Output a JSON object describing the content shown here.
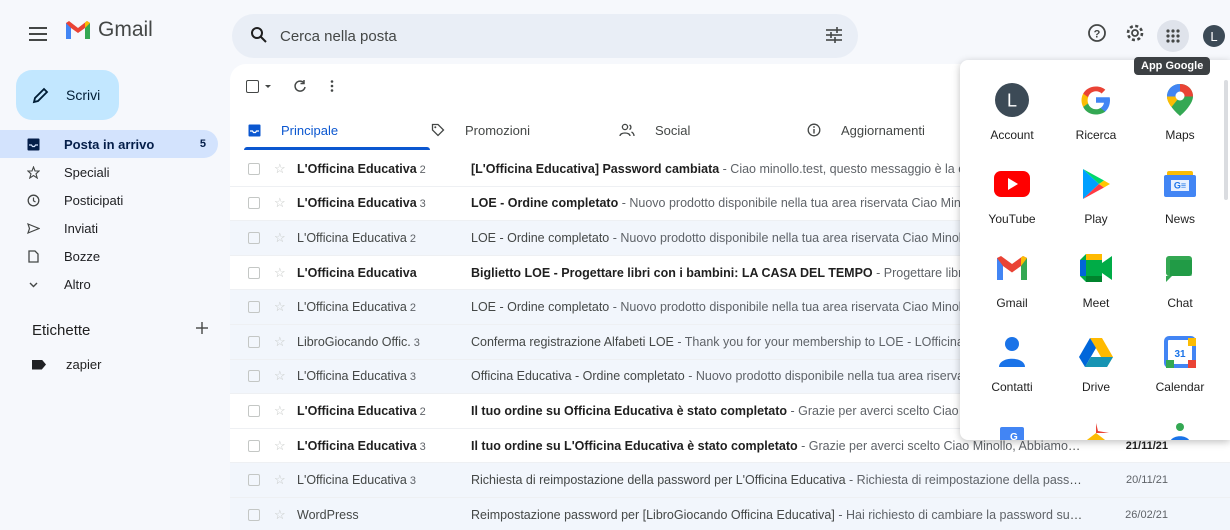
{
  "header": {
    "app_name": "Gmail",
    "search_placeholder": "Cerca nella posta",
    "avatar_initial": "L",
    "apps_tooltip": "App Google"
  },
  "sidebar": {
    "compose_label": "Scrivi",
    "items": [
      {
        "label": "Posta in arrivo",
        "count": "5",
        "icon": "inbox-icon",
        "active": true
      },
      {
        "label": "Speciali",
        "icon": "star-icon"
      },
      {
        "label": "Posticipati",
        "icon": "clock-icon"
      },
      {
        "label": "Inviati",
        "icon": "send-icon"
      },
      {
        "label": "Bozze",
        "icon": "draft-icon"
      },
      {
        "label": "Altro",
        "icon": "chevron-down-icon"
      }
    ],
    "labels_header": "Etichette",
    "labels": [
      {
        "name": "zapier"
      }
    ]
  },
  "tabs": [
    {
      "label": "Principale",
      "icon": "inbox-icon",
      "active": true
    },
    {
      "label": "Promozioni",
      "icon": "tag-icon"
    },
    {
      "label": "Social",
      "icon": "people-icon"
    },
    {
      "label": "Aggiornamenti",
      "icon": "info-icon"
    }
  ],
  "emails": [
    {
      "sender": "L'Officina Educativa",
      "count": "2",
      "subject": "[L'Officina Educativa] Password cambiata",
      "snippet": " - Ciao minollo.test, questo messaggio è la c",
      "date": "",
      "unread": true
    },
    {
      "sender": "L'Officina Educativa",
      "count": "3",
      "subject": "LOE - Ordine completato",
      "snippet": " - Nuovo prodotto disponibile nella tua area riservata Ciao Mino",
      "date": "",
      "unread": true
    },
    {
      "sender": "L'Officina Educativa",
      "count": "2",
      "subject": "LOE - Ordine completato",
      "snippet": " - Nuovo prodotto disponibile nella tua area riservata Ciao Minoll",
      "date": "",
      "unread": false
    },
    {
      "sender": "L'Officina Educativa",
      "count": "",
      "subject": "Biglietto LOE - Progettare libri con i bambini: LA CASA DEL TEMPO",
      "snippet": " - Progettare libri c",
      "date": "",
      "unread": true
    },
    {
      "sender": "L'Officina Educativa",
      "count": "2",
      "subject": "LOE - Ordine completato",
      "snippet": " - Nuovo prodotto disponibile nella tua area riservata Ciao Minoll",
      "date": "",
      "unread": false
    },
    {
      "sender": "LibroGiocando Offic.",
      "count": "3",
      "subject": "Conferma registrazione Alfabeti LOE",
      "snippet": " - Thank you for your membership to LOE - LOfficina",
      "date": "",
      "unread": false
    },
    {
      "sender": "L'Officina Educativa",
      "count": "3",
      "subject": "Officina Educativa - Ordine completato",
      "snippet": " - Nuovo prodotto disponibile nella tua area riserva",
      "date": "",
      "unread": false
    },
    {
      "sender": "L'Officina Educativa",
      "count": "2",
      "subject": "Il tuo ordine su Officina Educativa è stato completato",
      "snippet": " - Grazie per averci scelto Ciao I",
      "date": "",
      "unread": true
    },
    {
      "sender": "L'Officina Educativa",
      "count": "3",
      "subject": "Il tuo ordine su L'Officina Educativa è stato completato",
      "snippet": " - Grazie per averci scelto Ciao Minollo, Abbiamo t...",
      "date": "21/11/21",
      "unread": true
    },
    {
      "sender": "L'Officina Educativa",
      "count": "3",
      "subject": "Richiesta di reimpostazione della password per L'Officina Educativa",
      "snippet": " - Richiesta di reimpostazione della passw...",
      "date": "20/11/21",
      "unread": false
    },
    {
      "sender": "WordPress",
      "count": "",
      "subject": "Reimpostazione password per [LibroGiocando Officina Educativa]",
      "snippet": " - Hai richiesto di cambiare la password sul ...",
      "date": "26/02/21",
      "unread": false
    }
  ],
  "apps": [
    {
      "label": "Account",
      "icon": "account-icon"
    },
    {
      "label": "Ricerca",
      "icon": "google-search-icon"
    },
    {
      "label": "Maps",
      "icon": "maps-icon"
    },
    {
      "label": "YouTube",
      "icon": "youtube-icon"
    },
    {
      "label": "Play",
      "icon": "play-icon"
    },
    {
      "label": "News",
      "icon": "news-icon"
    },
    {
      "label": "Gmail",
      "icon": "gmail-icon"
    },
    {
      "label": "Meet",
      "icon": "meet-icon"
    },
    {
      "label": "Chat",
      "icon": "chat-icon"
    },
    {
      "label": "Contatti",
      "icon": "contacts-icon"
    },
    {
      "label": "Drive",
      "icon": "drive-icon"
    },
    {
      "label": "Calendar",
      "icon": "calendar-icon",
      "day": "31"
    }
  ],
  "colors": {
    "accent": "#0b57d0",
    "compose_bg": "#c2e7ff",
    "active_nav_bg": "#d3e3fd",
    "app_bg": "#f6f8fc"
  }
}
